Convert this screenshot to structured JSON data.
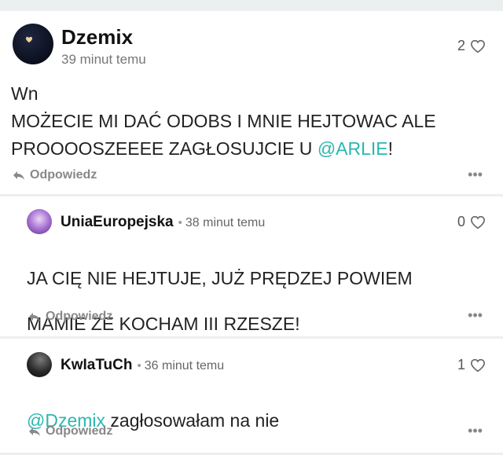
{
  "main_comment": {
    "author": "Dzemix",
    "time": "39 minut temu",
    "likes": "2",
    "text_lines": [
      "Wn",
      "MOŻECIE MI DAĆ ODOBS I MNIE HEJTOWAC ALE",
      "PROOOOSZEEEE ZAGŁOSUJCIE U "
    ],
    "mention": "@ARLIE",
    "text_end": "!",
    "reply_label": "Odpowiedz",
    "more_label": "•••",
    "heart_icon": "heart-outline-icon",
    "reply_icon": "reply-arrow-icon"
  },
  "replies": [
    {
      "author": "UniaEuropejska",
      "separator": "•",
      "time": "38 minut temu",
      "likes": "0",
      "text_lines": [
        "JA CIĘ NIE HEJTUJE, JUŻ PRĘDZEJ POWIEM",
        "MAMIE ZE KOCHAM III RZESZE!"
      ],
      "reply_label": "Odpowiedz",
      "more_label": "•••"
    },
    {
      "author": "KwIaTuCh",
      "separator": "•",
      "time": "36 minut temu",
      "likes": "1",
      "mention": "@Dzemix",
      "text": " zagłosowałam na nie",
      "reply_label": "Odpowiedz",
      "more_label": "•••"
    }
  ],
  "colors": {
    "background": "#eceff0",
    "card": "#ffffff",
    "mention": "#2bb7b0",
    "muted": "#888888"
  }
}
